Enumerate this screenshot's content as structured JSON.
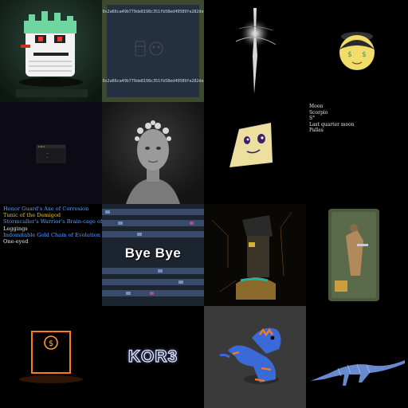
{
  "gallery": {
    "tiles": [
      {
        "name": "pixel-ghost-art"
      },
      {
        "name": "contract-card-art",
        "hex_top": "0x2a66ca49b779de8198c351fb58ed49589fe282de",
        "hex_bottom": "0x2a66ca49b779de8198c351fb58ed49589fe282de"
      },
      {
        "name": "glowing-spirit-art"
      },
      {
        "name": "money-face-art"
      },
      {
        "name": "dark-window-art",
        "window_text": "...",
        "window_sub": "..."
      },
      {
        "name": "silver-portrait-art"
      },
      {
        "name": "cube-face-art"
      },
      {
        "name": "planet-traits",
        "lines": [
          "Moon",
          "Scorpio",
          "S°",
          "Last quarter moon",
          "Pallas"
        ]
      },
      {
        "name": "item-traits",
        "lines": [
          {
            "text": "Honor Guard's Axe of Corrosion",
            "color": "#5aa0ff"
          },
          {
            "text": "Tunic of the Demigod",
            "color": "#e0c030"
          },
          {
            "text": "Stormcaller's Warrior's Brain-cage of Retribution",
            "color": "#5aa0ff"
          },
          {
            "text": "Leggings",
            "color": "#e8e8e8"
          },
          {
            "text": "Indomitable Gold Chain of Evolution",
            "color": "#5aa0ff"
          },
          {
            "text": "One-eyed",
            "color": "#e8e8e8"
          }
        ]
      },
      {
        "name": "bye-bye-art",
        "caption": "Bye Bye"
      },
      {
        "name": "robot-head-art"
      },
      {
        "name": "action-figure-art"
      },
      {
        "name": "neon-coin-art"
      },
      {
        "name": "korb-logo-art",
        "caption": "KOR3"
      },
      {
        "name": "blue-iguana-art"
      },
      {
        "name": "dinosaur-art"
      }
    ]
  }
}
